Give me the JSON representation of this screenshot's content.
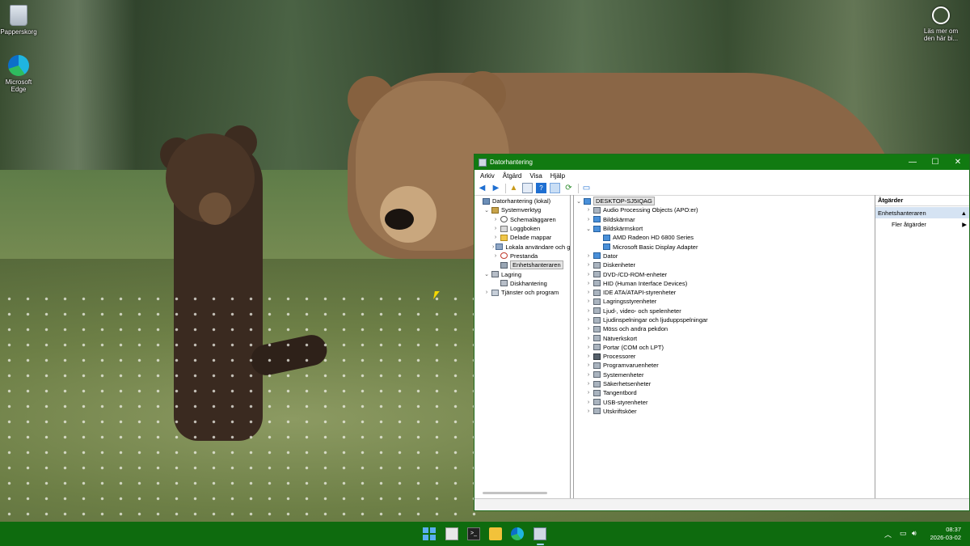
{
  "desktop": {
    "icons": [
      {
        "label": "Papperskorg",
        "icon": "recycle-bin-icon"
      },
      {
        "label": "Microsoft Edge",
        "icon": "edge-icon"
      }
    ],
    "learn_more": "Läs mer om den här bi..."
  },
  "window": {
    "title": "Datorhantering",
    "controls": {
      "minimize": "—",
      "maximize": "☐",
      "close": "✕"
    },
    "menu": [
      "Arkiv",
      "Åtgärd",
      "Visa",
      "Hjälp"
    ],
    "left_tree": [
      {
        "label": "Datorhantering (lokal)",
        "level": 0,
        "expander": "",
        "icon": "computer-management-icon"
      },
      {
        "label": "Systemverktyg",
        "level": 1,
        "expander": "v",
        "icon": "tools-icon"
      },
      {
        "label": "Schemaläggaren",
        "level": 2,
        "expander": ">",
        "icon": "clock-icon"
      },
      {
        "label": "Loggboken",
        "level": 2,
        "expander": ">",
        "icon": "log-icon"
      },
      {
        "label": "Delade mappar",
        "level": 2,
        "expander": ">",
        "icon": "folder-icon"
      },
      {
        "label": "Lokala användare och g",
        "level": 2,
        "expander": ">",
        "icon": "users-icon"
      },
      {
        "label": "Prestanda",
        "level": 2,
        "expander": ">",
        "icon": "performance-icon"
      },
      {
        "label": "Enhetshanteraren",
        "level": 2,
        "expander": "",
        "icon": "device-manager-icon",
        "selected": true
      },
      {
        "label": "Lagring",
        "level": 1,
        "expander": "v",
        "icon": "storage-icon"
      },
      {
        "label": "Diskhantering",
        "level": 2,
        "expander": "",
        "icon": "disk-icon"
      },
      {
        "label": "Tjänster och program",
        "level": 1,
        "expander": ">",
        "icon": "services-icon"
      }
    ],
    "device_tree": [
      {
        "label": "DESKTOP-SJ5IQAG",
        "level": 0,
        "expander": "v",
        "icon": "computer-icon",
        "selected": true
      },
      {
        "label": "Audio Processing Objects (APO:er)",
        "level": 1,
        "expander": ">",
        "icon": "audio-icon"
      },
      {
        "label": "Bildskärmar",
        "level": 1,
        "expander": ">",
        "icon": "monitor-icon"
      },
      {
        "label": "Bildskärmskort",
        "level": 1,
        "expander": "v",
        "icon": "display-adapter-icon"
      },
      {
        "label": "AMD Radeon HD 6800 Series",
        "level": 2,
        "expander": "",
        "icon": "display-adapter-icon"
      },
      {
        "label": "Microsoft Basic Display Adapter",
        "level": 2,
        "expander": "",
        "icon": "display-adapter-icon"
      },
      {
        "label": "Dator",
        "level": 1,
        "expander": ">",
        "icon": "computer-icon"
      },
      {
        "label": "Diskenheter",
        "level": 1,
        "expander": ">",
        "icon": "disk-drive-icon"
      },
      {
        "label": "DVD-/CD-ROM-enheter",
        "level": 1,
        "expander": ">",
        "icon": "dvd-icon"
      },
      {
        "label": "HID (Human Interface Devices)",
        "level": 1,
        "expander": ">",
        "icon": "hid-icon"
      },
      {
        "label": "IDE ATA/ATAPI-styrenheter",
        "level": 1,
        "expander": ">",
        "icon": "ide-icon"
      },
      {
        "label": "Lagringsstyrenheter",
        "level": 1,
        "expander": ">",
        "icon": "storage-controller-icon"
      },
      {
        "label": "Ljud-, video- och spelenheter",
        "level": 1,
        "expander": ">",
        "icon": "sound-icon"
      },
      {
        "label": "Ljudinspelningar och ljuduppspelningar",
        "level": 1,
        "expander": ">",
        "icon": "audio-io-icon"
      },
      {
        "label": "Möss och andra pekdon",
        "level": 1,
        "expander": ">",
        "icon": "mouse-icon"
      },
      {
        "label": "Nätverkskort",
        "level": 1,
        "expander": ">",
        "icon": "network-icon"
      },
      {
        "label": "Portar (COM och LPT)",
        "level": 1,
        "expander": ">",
        "icon": "port-icon"
      },
      {
        "label": "Processorer",
        "level": 1,
        "expander": ">",
        "icon": "processor-icon"
      },
      {
        "label": "Programvaruenheter",
        "level": 1,
        "expander": ">",
        "icon": "software-device-icon"
      },
      {
        "label": "Systemenheter",
        "level": 1,
        "expander": ">",
        "icon": "system-device-icon"
      },
      {
        "label": "Säkerhetsenheter",
        "level": 1,
        "expander": ">",
        "icon": "security-device-icon"
      },
      {
        "label": "Tangentbord",
        "level": 1,
        "expander": ">",
        "icon": "keyboard-icon"
      },
      {
        "label": "USB-styrenheter",
        "level": 1,
        "expander": ">",
        "icon": "usb-icon"
      },
      {
        "label": "Utskriftsköer",
        "level": 1,
        "expander": ">",
        "icon": "printer-icon"
      }
    ],
    "actions": {
      "header": "Åtgärder",
      "section": "Enhetshanteraren",
      "items": [
        "Fler åtgärder"
      ]
    }
  },
  "taskbar": {
    "apps": [
      "start-icon",
      "task-view-icon",
      "terminal-icon",
      "file-explorer-icon",
      "edge-icon",
      "computer-management-icon"
    ],
    "time": "08:37",
    "date": "2026-03-02"
  },
  "colors": {
    "titlebar": "#117a11",
    "taskbar": "#0e6b0e"
  }
}
